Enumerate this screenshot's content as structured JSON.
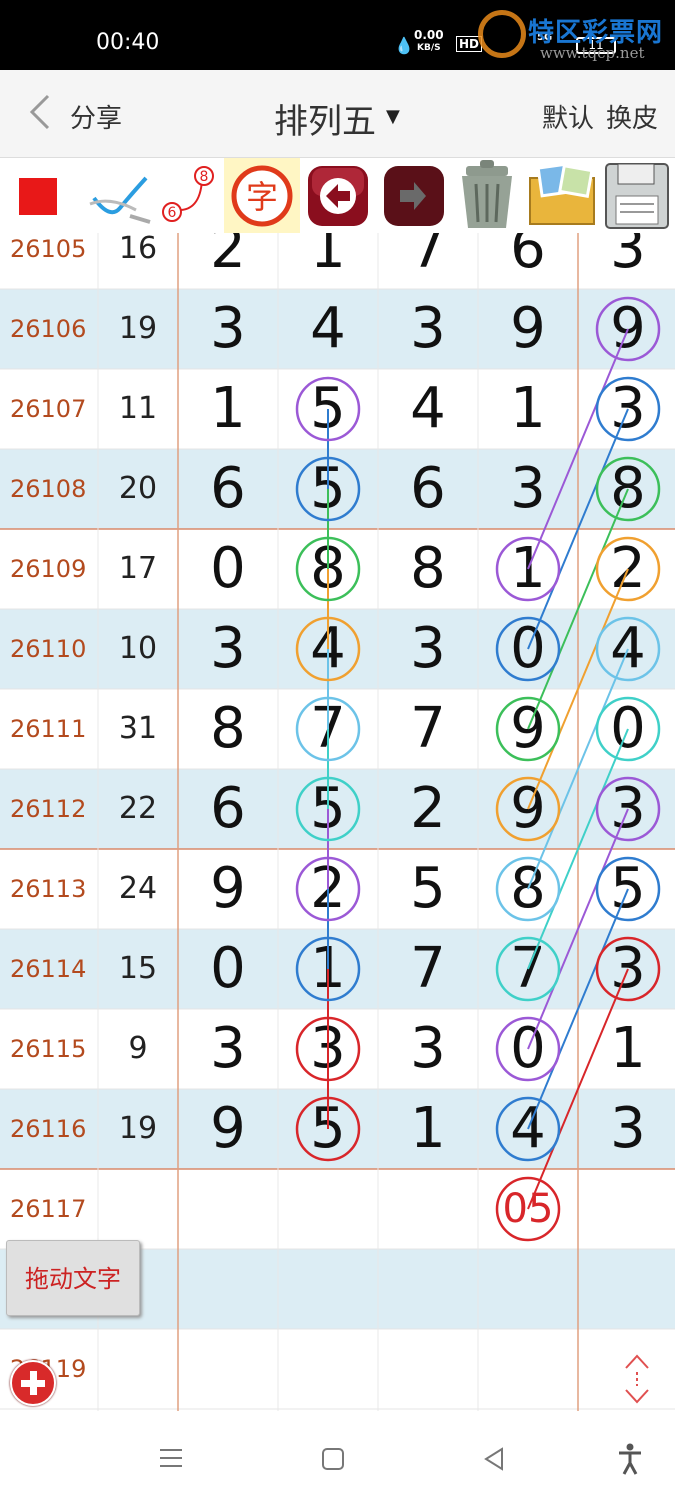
{
  "status_bar": {
    "time": "00:40",
    "net_speed": "0.00",
    "net_unit": "KB/S",
    "hd": "HD",
    "signal": "5G",
    "battery": "11"
  },
  "watermark": {
    "text": "特区彩票网",
    "url": "www.tqcp.net"
  },
  "header": {
    "share_label": "分享",
    "title": "排列五",
    "default_label": "默认",
    "skin_label": "换皮"
  },
  "toolbar": {
    "icons": [
      "red-square-icon",
      "pen-check-icon",
      "connect-6-8-icon",
      "char-icon",
      "back-arrow-icon",
      "forward-arrow-icon",
      "trash-icon",
      "gallery-icon",
      "save-disk-icon"
    ],
    "connect_from": "6",
    "connect_to": "8",
    "char_label": "字"
  },
  "rows": [
    {
      "period": "26105",
      "sum": "16",
      "d": [
        "2",
        "1",
        "7",
        "6",
        "3"
      ]
    },
    {
      "period": "26106",
      "sum": "19",
      "d": [
        "3",
        "4",
        "3",
        "9",
        "9"
      ]
    },
    {
      "period": "26107",
      "sum": "11",
      "d": [
        "1",
        "5",
        "4",
        "1",
        "3"
      ]
    },
    {
      "period": "26108",
      "sum": "20",
      "d": [
        "6",
        "5",
        "6",
        "3",
        "8"
      ]
    },
    {
      "period": "26109",
      "sum": "17",
      "d": [
        "0",
        "8",
        "8",
        "1",
        "2"
      ]
    },
    {
      "period": "26110",
      "sum": "10",
      "d": [
        "3",
        "4",
        "3",
        "0",
        "4"
      ]
    },
    {
      "period": "26111",
      "sum": "31",
      "d": [
        "8",
        "7",
        "7",
        "9",
        "0"
      ]
    },
    {
      "period": "26112",
      "sum": "22",
      "d": [
        "6",
        "5",
        "2",
        "9",
        "3"
      ]
    },
    {
      "period": "26113",
      "sum": "24",
      "d": [
        "9",
        "2",
        "5",
        "8",
        "5"
      ]
    },
    {
      "period": "26114",
      "sum": "15",
      "d": [
        "0",
        "1",
        "7",
        "7",
        "3"
      ]
    },
    {
      "period": "26115",
      "sum": "9",
      "d": [
        "3",
        "3",
        "3",
        "0",
        "1"
      ]
    },
    {
      "period": "26116",
      "sum": "19",
      "d": [
        "9",
        "5",
        "1",
        "4",
        "3"
      ]
    },
    {
      "period": "26117",
      "sum": "",
      "d": [
        "",
        "",
        "",
        "05",
        ""
      ]
    },
    {
      "period": "",
      "sum": "",
      "d": [
        "",
        "",
        "",
        "",
        ""
      ]
    },
    {
      "period": "26119",
      "sum": "",
      "d": [
        "",
        "",
        "",
        "",
        ""
      ]
    }
  ],
  "colors": {
    "purple": "#9b59d6",
    "blue": "#2f7ccf",
    "green": "#3cbf5a",
    "orange": "#f0a030",
    "lightblue": "#6cc3e8",
    "teal": "#3fd0c8",
    "red": "#d8262a",
    "stripe": "#dcedf4",
    "period": "#b34a1e"
  },
  "markers": [
    {
      "row": 2,
      "col": 1,
      "color": "purple"
    },
    {
      "row": 3,
      "col": 1,
      "color": "blue"
    },
    {
      "row": 4,
      "col": 1,
      "color": "green"
    },
    {
      "row": 5,
      "col": 1,
      "color": "orange"
    },
    {
      "row": 6,
      "col": 1,
      "color": "lightblue"
    },
    {
      "row": 7,
      "col": 1,
      "color": "teal"
    },
    {
      "row": 8,
      "col": 1,
      "color": "purple"
    },
    {
      "row": 9,
      "col": 1,
      "color": "blue"
    },
    {
      "row": 10,
      "col": 1,
      "color": "red"
    },
    {
      "row": 11,
      "col": 1,
      "color": "red"
    },
    {
      "row": 1,
      "col": 4,
      "color": "purple"
    },
    {
      "row": 2,
      "col": 4,
      "color": "blue"
    },
    {
      "row": 3,
      "col": 4,
      "color": "green"
    },
    {
      "row": 4,
      "col": 4,
      "color": "orange"
    },
    {
      "row": 5,
      "col": 4,
      "color": "lightblue"
    },
    {
      "row": 6,
      "col": 4,
      "color": "teal"
    },
    {
      "row": 7,
      "col": 4,
      "color": "purple"
    },
    {
      "row": 8,
      "col": 4,
      "color": "blue"
    },
    {
      "row": 9,
      "col": 4,
      "color": "red"
    },
    {
      "row": 4,
      "col": 3,
      "color": "purple"
    },
    {
      "row": 5,
      "col": 3,
      "color": "blue"
    },
    {
      "row": 6,
      "col": 3,
      "color": "green"
    },
    {
      "row": 7,
      "col": 3,
      "color": "orange"
    },
    {
      "row": 8,
      "col": 3,
      "color": "lightblue"
    },
    {
      "row": 9,
      "col": 3,
      "color": "teal"
    },
    {
      "row": 10,
      "col": 3,
      "color": "purple"
    },
    {
      "row": 11,
      "col": 3,
      "color": "blue"
    },
    {
      "row": 12,
      "col": 3,
      "color": "red"
    }
  ],
  "links": [
    {
      "a": [
        2,
        1
      ],
      "b": [
        11,
        1
      ],
      "color": "purple",
      "vertical": true
    },
    {
      "a": [
        1,
        4
      ],
      "b": [
        4,
        3
      ],
      "color": "purple"
    },
    {
      "a": [
        2,
        4
      ],
      "b": [
        5,
        3
      ],
      "color": "blue"
    },
    {
      "a": [
        3,
        4
      ],
      "b": [
        6,
        3
      ],
      "color": "green"
    },
    {
      "a": [
        4,
        4
      ],
      "b": [
        7,
        3
      ],
      "color": "orange"
    },
    {
      "a": [
        5,
        4
      ],
      "b": [
        8,
        3
      ],
      "color": "lightblue"
    },
    {
      "a": [
        6,
        4
      ],
      "b": [
        9,
        3
      ],
      "color": "teal"
    },
    {
      "a": [
        7,
        4
      ],
      "b": [
        10,
        3
      ],
      "color": "purple"
    },
    {
      "a": [
        8,
        4
      ],
      "b": [
        11,
        3
      ],
      "color": "blue"
    },
    {
      "a": [
        9,
        4
      ],
      "b": [
        12,
        3
      ],
      "color": "red"
    }
  ],
  "drag_button": {
    "label": "拖动文字"
  },
  "system_nav": {
    "icons": [
      "menu-icon",
      "home-icon",
      "back-icon",
      "accessibility-icon"
    ]
  }
}
